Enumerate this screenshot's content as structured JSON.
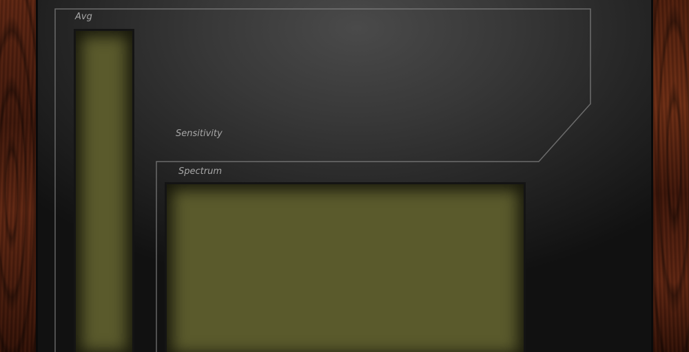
{
  "colors": {
    "panel": "#383838",
    "wood": "#4a1c0c",
    "screen": "#5a5a2c",
    "outline": "#8a8a8a",
    "label": "#a8a8a8"
  },
  "labels": {
    "avg": "Avg",
    "sensitivity": "Sensitivity",
    "spectrum": "Spectrum"
  }
}
